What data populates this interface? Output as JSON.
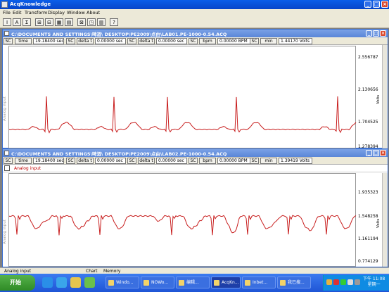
{
  "app": {
    "title": "AcqKnowledge"
  },
  "menu": [
    "File",
    "Edit",
    "Transform",
    "Display",
    "Window",
    "About"
  ],
  "toolbar": [
    "I",
    "A",
    "Σ",
    "⊞",
    "⊟",
    "▦",
    "▤",
    "⊠",
    "◳",
    "▥",
    "?"
  ],
  "windows": [
    {
      "title": "C:\\DOCUMENTS AND SETTINGS\\啤酒\\ DESKTOP\\PE2009\\点由\\LAB01.PE-1000-0.54.ACQ",
      "measurements": [
        {
          "label": "SC",
          "type": "time",
          "value": "19.18400 sec"
        },
        {
          "label": "SC",
          "type": "delta t",
          "value": "0.00000 sec"
        },
        {
          "label": "SC",
          "type": "delta t",
          "value": "0.00000 sec"
        },
        {
          "label": "SC",
          "type": "bpm",
          "value": "0.00000 BPM"
        },
        {
          "label": "SC",
          "type": "min",
          "value": "1.44170 Volts"
        }
      ],
      "y_axis_label": "Analog input",
      "y_unit": "Volts",
      "ticks": [
        "2.556787",
        "2.130656",
        "1.704525",
        "1.278394"
      ]
    },
    {
      "title": "C:\\DOCUMENTS AND SETTINGS\\啤酒\\ DESKTOP\\PE2009\\点由\\LAB02.PE-1000-0.54.ACQ",
      "measurements": [
        {
          "label": "SC",
          "type": "time",
          "value": "19.18400 sec"
        },
        {
          "label": "SC",
          "type": "delta t",
          "value": "0.00000 sec"
        },
        {
          "label": "SC",
          "type": "delta t",
          "value": "0.00000 sec"
        },
        {
          "label": "SC",
          "type": "bpm",
          "value": "0.00000 BPM"
        },
        {
          "label": "SC",
          "type": "min",
          "value": "1.39419 Volts"
        }
      ],
      "channel_label": "Analog input",
      "y_axis_label": "Analog input",
      "y_unit": "Volts",
      "ticks": [
        "1.935323",
        "1.548258",
        "1.161194",
        "0.774129"
      ]
    }
  ],
  "status": {
    "left": "Analog input",
    "tabs": [
      "Chart",
      "Memory"
    ]
  },
  "taskbar": {
    "start": "开始",
    "tasks": [
      "Windo...",
      "NOWo...",
      "编辑...",
      "AcqKn...",
      "Inbet...",
      "我已搜..."
    ],
    "clock": "下午 11:08",
    "day": "星期一"
  },
  "colors": {
    "signal": "#c81e1e",
    "title_blue": "#0a5ee9"
  }
}
